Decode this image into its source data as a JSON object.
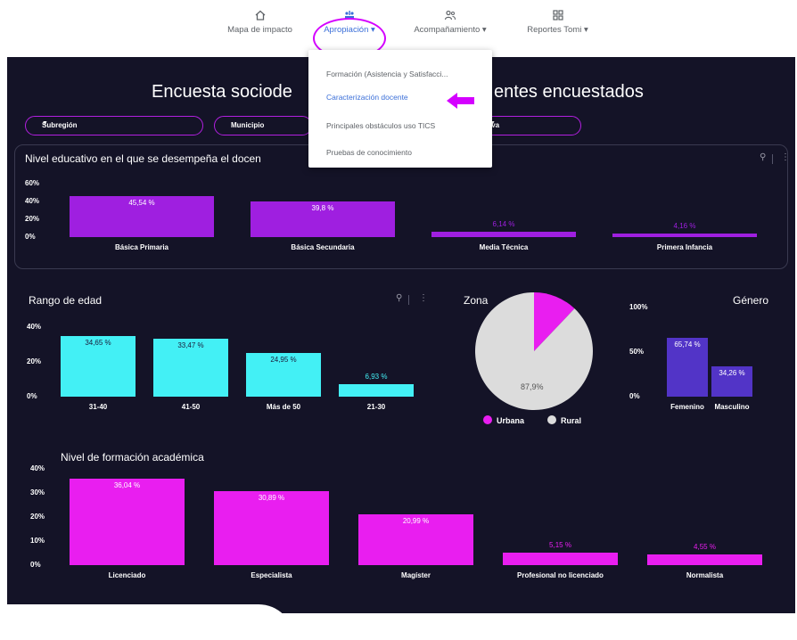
{
  "nav": {
    "items": [
      {
        "label": "Mapa de impacto",
        "icon": "home-icon"
      },
      {
        "label": "Apropiación ▾",
        "icon": "people-chart-icon"
      },
      {
        "label": "Acompañamiento ▾",
        "icon": "group-icon"
      },
      {
        "label": "Reportes Tomi ▾",
        "icon": "grid-icon"
      }
    ],
    "active": "Apropiación ▾"
  },
  "dropdown": {
    "items": [
      "Formación (Asistencia y Satisfacci...",
      "Caracterización docente",
      "Principales obstáculos uso TICS",
      "Pruebas de conocimiento"
    ],
    "selected": "Caracterización docente"
  },
  "dashboard": {
    "title_left": "Encuesta sociode",
    "title_right": "entes encuestados",
    "filters": [
      {
        "label": "Subregión"
      },
      {
        "label": "Municipio"
      },
      {
        "label": "iva"
      }
    ]
  },
  "colors": {
    "background": "#141327",
    "purple": "#9f1fe0",
    "cyan": "#43f0f5",
    "indigo": "#5234c7",
    "magenta": "#e91ef0",
    "pie_light": "#dcdcdc",
    "highlight": "#d400ff"
  },
  "chart_data": [
    {
      "type": "bar",
      "title": "Nivel educativo en el que se desempeña el docen",
      "categories": [
        "Básica Primaria",
        "Básica Secundaria",
        "Media Técnica",
        "Primera Infancia"
      ],
      "values": [
        45.54,
        39.8,
        6.14,
        4.16
      ],
      "labels": [
        "45,54 %",
        "39,8 %",
        "6,14 %",
        "4,16 %"
      ],
      "yticks": [
        "60%",
        "40%",
        "20%",
        "0%"
      ],
      "ylim": [
        0,
        60
      ]
    },
    {
      "type": "bar",
      "title": "Rango de edad",
      "categories": [
        "31-40",
        "41-50",
        "Más de 50",
        "21-30"
      ],
      "values": [
        34.65,
        33.47,
        24.95,
        6.93
      ],
      "labels": [
        "34,65 %",
        "33,47 %",
        "24,95 %",
        "6,93 %"
      ],
      "yticks": [
        "40%",
        "20%",
        "0%"
      ],
      "ylim": [
        0,
        40
      ]
    },
    {
      "type": "pie",
      "title": "Zona",
      "categories": [
        "Urbana",
        "Rural"
      ],
      "values": [
        12.1,
        87.9
      ],
      "labels": [
        "",
        "87,9%"
      ]
    },
    {
      "type": "bar",
      "title": "Género",
      "categories": [
        "Femenino",
        "Masculino"
      ],
      "values": [
        65.74,
        34.26
      ],
      "labels": [
        "65,74 %",
        "34,26 %"
      ],
      "yticks": [
        "100%",
        "50%",
        "0%"
      ],
      "ylim": [
        0,
        100
      ]
    },
    {
      "type": "bar",
      "title": "Nivel de formación académica",
      "categories": [
        "Licenciado",
        "Especialista",
        "Magíster",
        "Profesional no licenciado",
        "Normalista"
      ],
      "values": [
        36.04,
        30.89,
        20.99,
        5.15,
        4.55
      ],
      "labels": [
        "36,04 %",
        "30,89 %",
        "20,99 %",
        "5,15 %",
        "4,55 %"
      ],
      "yticks": [
        "40%",
        "30%",
        "20%",
        "10%",
        "0%"
      ],
      "ylim": [
        0,
        40
      ]
    }
  ]
}
